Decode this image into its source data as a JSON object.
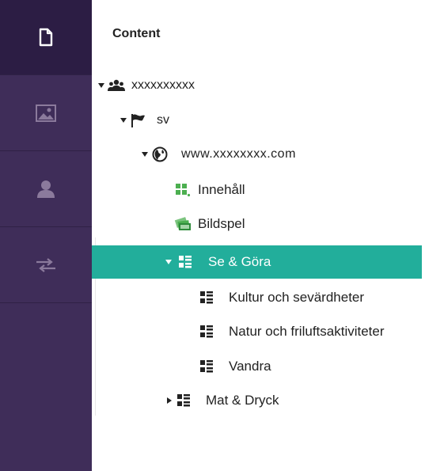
{
  "sidebar": {
    "items": [
      {
        "icon": "document-icon",
        "active": true
      },
      {
        "icon": "image-icon",
        "active": false
      },
      {
        "icon": "user-icon",
        "active": false
      },
      {
        "icon": "transfer-arrows-icon",
        "active": false
      }
    ],
    "colors": {
      "background": "#3f2d59",
      "active": "#2c1d44",
      "icon_active": "#ffffff",
      "icon_inactive": "#8b7a9c"
    }
  },
  "content": {
    "title": "Content",
    "tree": {
      "root": {
        "label": "xxxxxxxxxx",
        "icon": "group-icon",
        "expanded": true
      },
      "language": {
        "label": "sv",
        "icon": "flag-icon",
        "expanded": true
      },
      "site": {
        "label": "www.xxxxxxxx.com",
        "icon": "globe-icon",
        "expanded": true
      },
      "nodes": [
        {
          "label": "Innehåll",
          "icon": "grid-content-icon"
        },
        {
          "label": "Bildspel",
          "icon": "slideshow-icon"
        },
        {
          "label": "Se & Göra",
          "icon": "list-icon",
          "expanded": true,
          "selected": true
        },
        {
          "label": "Kultur och sevärdheter",
          "icon": "list-icon"
        },
        {
          "label": "Natur och friluftsaktiviteter",
          "icon": "list-icon"
        },
        {
          "label": "Vandra",
          "icon": "list-icon"
        },
        {
          "label": "Mat & Dryck",
          "icon": "list-icon",
          "expanded": false
        }
      ]
    },
    "colors": {
      "selected": "#22ae9b",
      "text": "#222222",
      "green": "#4caf50"
    }
  }
}
